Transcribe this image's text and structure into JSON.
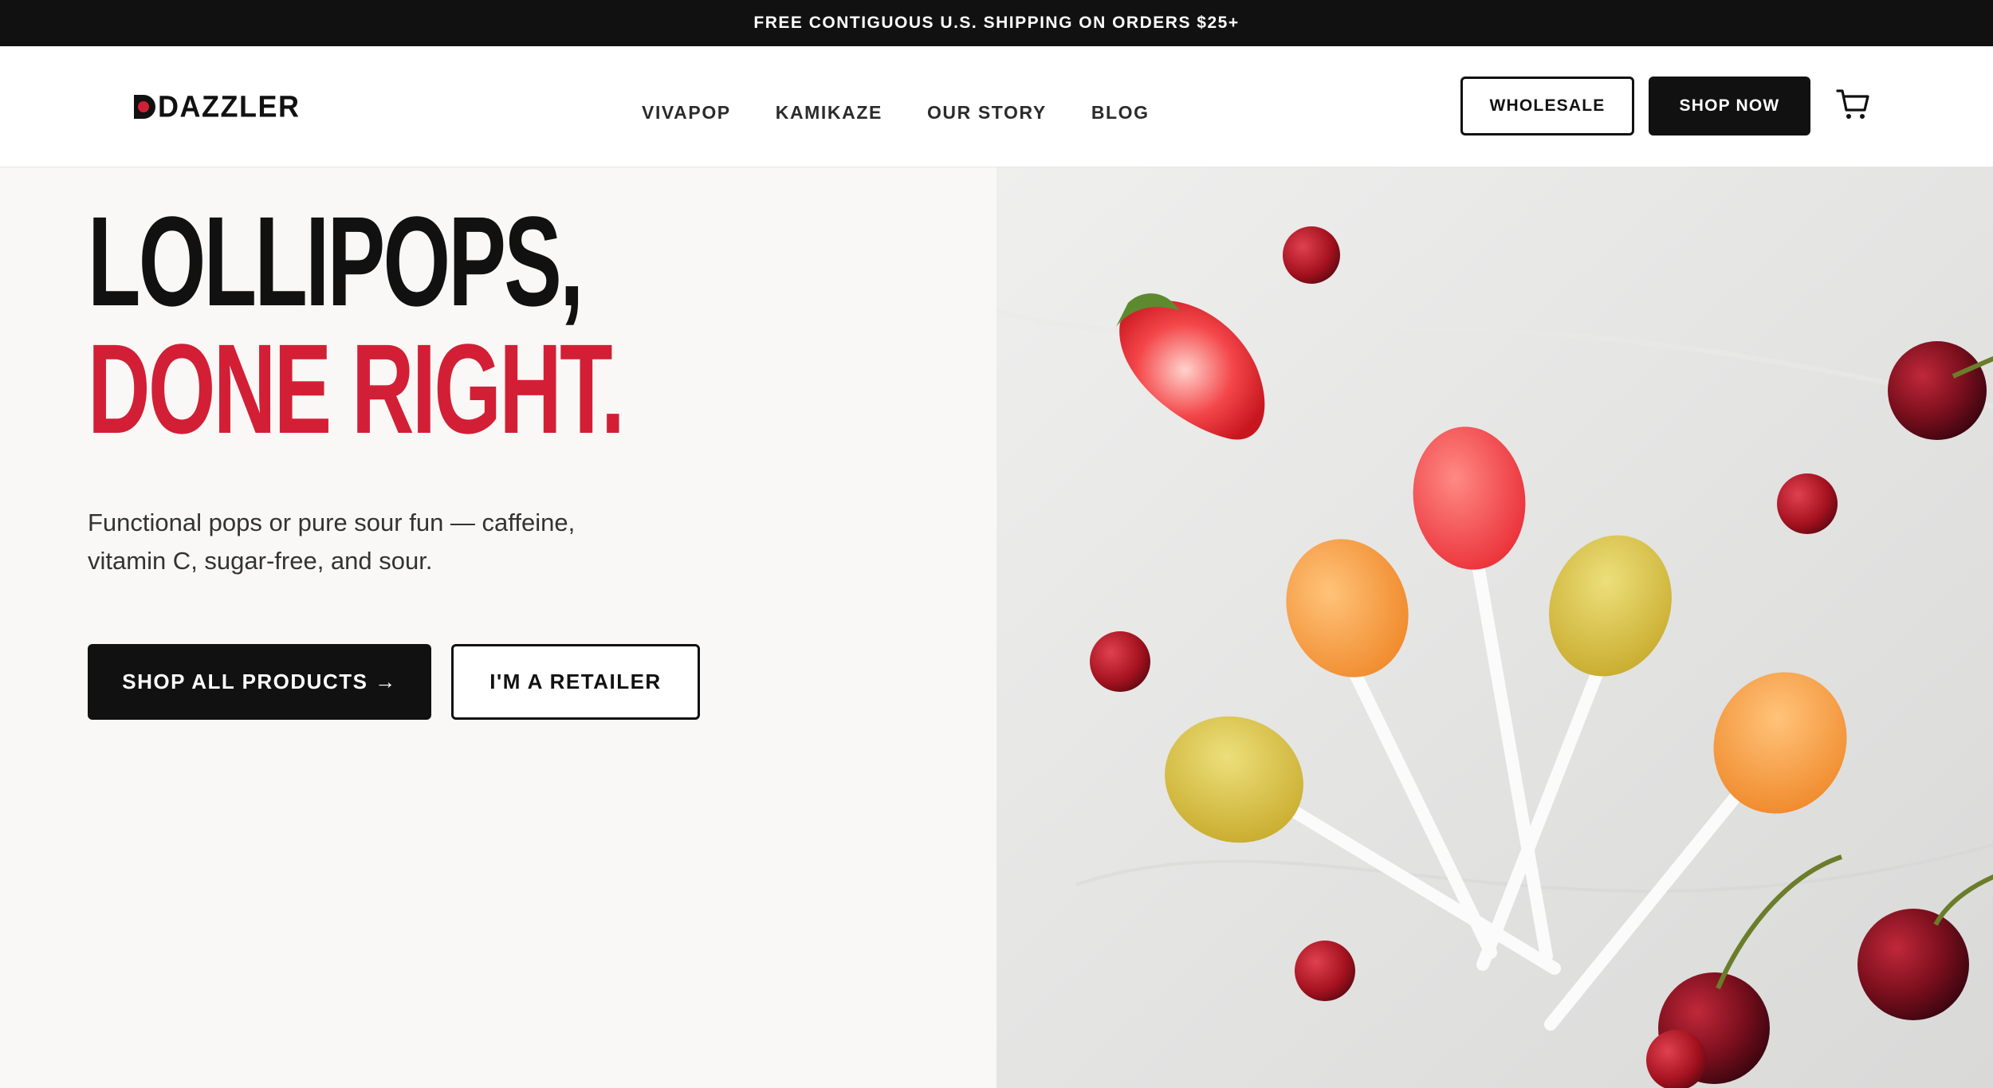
{
  "announcement": {
    "text": "FREE CONTIGUOUS U.S. SHIPPING ON ORDERS $25+"
  },
  "brand": {
    "name": "DAZZLER",
    "accent_color": "#d21f35"
  },
  "nav": {
    "items": [
      {
        "label": "VIVAPOP"
      },
      {
        "label": "KAMIKAZE"
      },
      {
        "label": "OUR STORY"
      },
      {
        "label": "BLOG"
      }
    ]
  },
  "header_actions": {
    "wholesale_label": "WHOLESALE",
    "shop_now_label": "SHOP NOW",
    "cart_icon": "cart-icon"
  },
  "hero": {
    "headline_line1": "LOLLIPOPS,",
    "headline_line2": "DONE RIGHT.",
    "subtext": "Functional pops or pure sour fun — caffeine, vitamin C, sugar-free, and sour.",
    "primary_button": "SHOP ALL PRODUCTS →",
    "secondary_button": "I'M A RETAILER"
  },
  "colors": {
    "announcement_bg": "#111111",
    "hero_left_bg": "#f9f8f6",
    "primary_button_bg": "#111111"
  }
}
